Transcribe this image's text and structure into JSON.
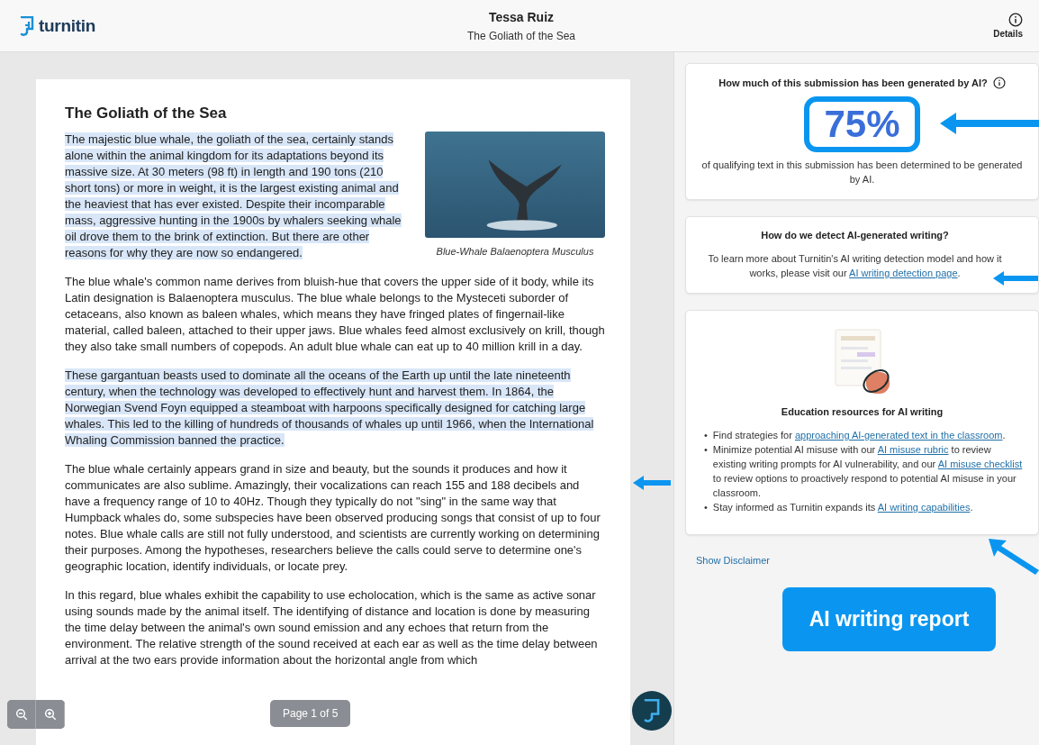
{
  "header": {
    "logo": "turnitin",
    "student": "Tessa Ruiz",
    "title": "The Goliath of the Sea",
    "details": "Details"
  },
  "document": {
    "heading": "The Goliath of the Sea",
    "figure_caption": "Blue-Whale Balaenoptera Musculus",
    "paragraphs": [
      {
        "text": "The majestic blue whale, the goliath of the sea, certainly stands alone within the animal kingdom for its adaptations beyond its massive size. At 30 meters (98 ft) in length and 190 tons (210 short tons) or more in weight, it is the largest existing animal and the heaviest that has ever existed. Despite their incomparable mass, aggressive hunting in the 1900s by whalers seeking whale oil drove them to the brink of extinction. But there are other reasons for why they are now so endangered.",
        "highlighted": true
      },
      {
        "text": "The blue whale's common name derives from bluish-hue that covers the upper side of it body, while its Latin designation is Balaenoptera musculus. The blue whale belongs to the Mysteceti suborder of cetaceans, also known as baleen whales, which means they have fringed plates of fingernail-like material, called baleen, attached to their upper jaws. Blue whales feed almost exclusively on krill, though they also take small numbers of copepods. An adult blue whale can eat up to 40 million krill in a day.",
        "highlighted": false
      },
      {
        "text": "These gargantuan beasts used to dominate all the oceans of the Earth up until the late nineteenth century, when the technology was developed to effectively hunt and harvest them. In 1864, the Norwegian Svend Foyn equipped a steamboat with harpoons specifically designed for catching large whales. This led to the killing of hundreds of thousands of whales up until 1966, when the International Whaling Commission banned the practice.",
        "highlighted": true
      },
      {
        "text": "The blue whale certainly appears grand in size and beauty, but the sounds it produces and how it communicates are also sublime. Amazingly, their vocalizations can reach 155 and 188 decibels and have a frequency range of 10 to 40Hz. Though they typically do not \"sing\" in the same way that Humpback whales do, some subspecies have been observed producing songs that consist of up to four notes. Blue whale calls are still not fully understood, and scientists are currently working on determining their purposes. Among the hypotheses, researchers believe the calls could serve to determine one's geographic location, identify individuals, or locate prey.",
        "highlighted": false
      },
      {
        "text": "In this regard, blue whales exhibit the capability to use echolocation, which is the same as active sonar using sounds made by the animal itself. The identifying of distance and location is done by measuring the time delay between the animal's own sound emission and any echoes that return from the environment. The relative strength of the sound received at each ear as well as the time delay between arrival at the two ears provide information about the horizontal angle from which",
        "highlighted": false
      }
    ],
    "page_indicator": "Page 1 of 5"
  },
  "report": {
    "score_card": {
      "question": "How much of this submission has been generated by AI?",
      "score": "75%",
      "description": "of qualifying text in this submission has been determined to be generated by AI."
    },
    "detect_card": {
      "heading": "How do we detect AI-generated writing?",
      "text_before": "To learn more about Turnitin's AI writing detection model and how it works, please visit our ",
      "link": "AI writing detection page",
      "text_after": "."
    },
    "resources_card": {
      "heading": "Education resources for AI writing",
      "items": [
        {
          "bullet": "•",
          "parts": [
            {
              "text": "Find strategies for ",
              "link": false
            },
            {
              "text": "approaching AI-generated text in the classroom",
              "link": true
            },
            {
              "text": ".",
              "link": false
            }
          ]
        },
        {
          "bullet": "•",
          "parts": [
            {
              "text": "Minimize potential AI misuse with our ",
              "link": false
            },
            {
              "text": "AI misuse rubric",
              "link": true
            },
            {
              "text": " to review existing writing prompts for AI vulnerability, and our ",
              "link": false
            },
            {
              "text": "AI misuse checklist",
              "link": true
            },
            {
              "text": " to review options to proactively respond to potential AI misuse in your classroom.",
              "link": false
            }
          ]
        },
        {
          "bullet": "•",
          "parts": [
            {
              "text": "Stay informed as Turnitin expands its ",
              "link": false
            },
            {
              "text": "AI writing capabilities",
              "link": true
            },
            {
              "text": ".",
              "link": false
            }
          ]
        }
      ]
    },
    "disclaimer_link": "Show Disclaimer"
  },
  "annotation": {
    "label": "AI writing report"
  }
}
